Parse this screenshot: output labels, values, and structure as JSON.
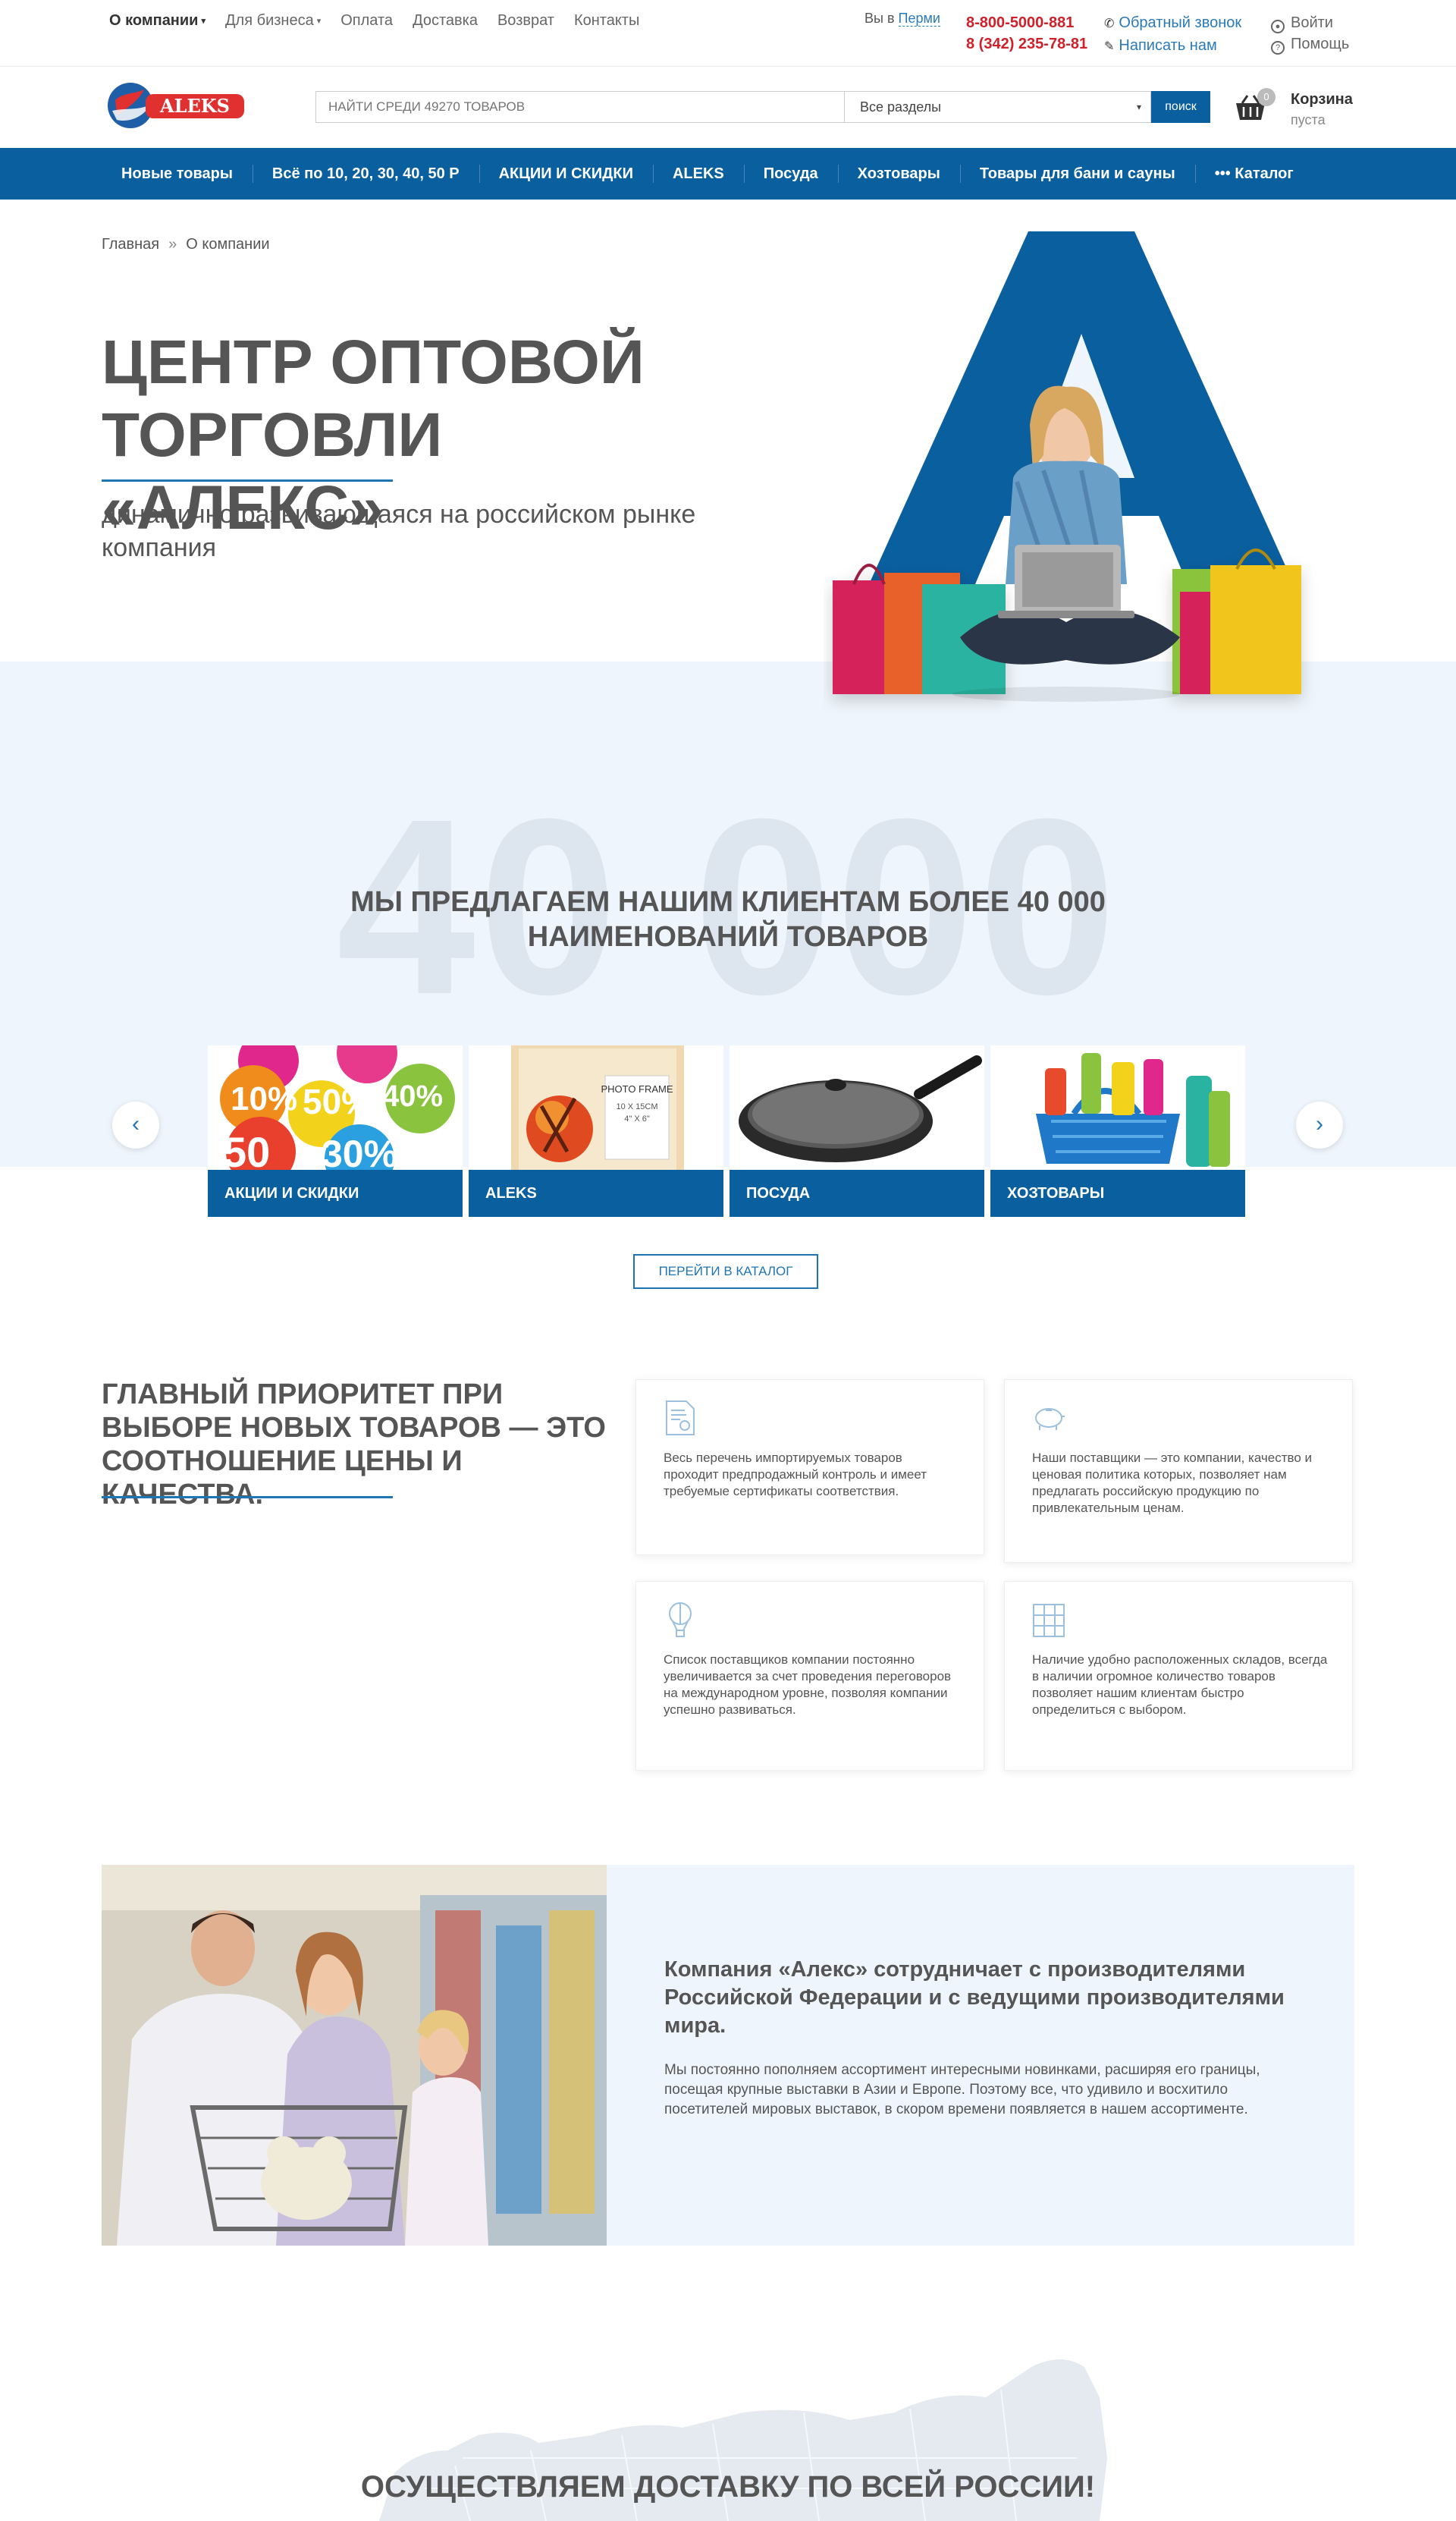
{
  "topbar": {
    "nav": [
      {
        "label": "О компании",
        "active": true,
        "dropdown": true
      },
      {
        "label": "Для бизнеса",
        "active": false,
        "dropdown": true
      },
      {
        "label": "Оплата",
        "active": false,
        "dropdown": false
      },
      {
        "label": "Доставка",
        "active": false,
        "dropdown": false
      },
      {
        "label": "Возврат",
        "active": false,
        "dropdown": false
      },
      {
        "label": "Контакты",
        "active": false,
        "dropdown": false
      }
    ],
    "city_prefix": "Вы в",
    "city": "Перми",
    "phone1": "8-800-5000-881",
    "phone2": "8 (342) 235-78-81",
    "callback": "Обратный звонок",
    "write_us": "Написать нам",
    "login": "Войти",
    "help": "Помощь"
  },
  "header": {
    "logo_text": "ALEKS",
    "search_placeholder": "НАЙТИ СРЕДИ 49270 ТОВАРОВ",
    "category_select": "Все разделы",
    "search_button": "поиск",
    "cart_count": "0",
    "cart_title": "Корзина",
    "cart_status": "пуста"
  },
  "mainnav": {
    "items": [
      "Новые товары",
      "Всё по 10, 20, 30, 40, 50 Р",
      "АКЦИИ И СКИДКИ",
      "ALEKS",
      "Посуда",
      "Хозтовары",
      "Товары для бани и сауны",
      "••• Каталог"
    ]
  },
  "hero": {
    "breadcrumb": [
      "Главная",
      "О компании"
    ],
    "title": "ЦЕНТР ОПТОВОЙ ТОРГОВЛИ «АЛЕКС»",
    "subtitle": "динамично развивающаяся на российском рынке компания"
  },
  "offer": {
    "big_number": "40 000",
    "title": "МЫ ПРЕДЛАГАЕМ НАШИМ КЛИЕНТАМ БОЛЕЕ 40 000 НАИМЕНОВАНИЙ ТОВАРОВ",
    "cards": [
      {
        "label": "АКЦИИ И СКИДКИ",
        "image": "discount-stickers"
      },
      {
        "label": "ALEKS",
        "image": "photo-frame"
      },
      {
        "label": "ПОСУДА",
        "image": "frying-pan"
      },
      {
        "label": "ХОЗТОВАРЫ",
        "image": "cleaning-supplies"
      }
    ],
    "photo_frame_text": "PHOTO FRAME",
    "photo_frame_size": "10 X 15CM",
    "photo_frame_size2": "4\" X 6\"",
    "catalog_button": "ПЕРЕЙТИ В КАТАЛОГ"
  },
  "priority": {
    "title": "ГЛАВНЫЙ ПРИОРИТЕТ ПРИ ВЫБОРЕ НОВЫХ ТОВАРОВ — ЭТО СООТНОШЕНИЕ ЦЕНЫ И КАЧЕСТВА.",
    "features": [
      {
        "icon": "certificate-icon",
        "text": "Весь перечень импортируемых товаров проходит предпродажный контроль и имеет требуемые сертификаты соответствия."
      },
      {
        "icon": "piggy-bank-icon",
        "text": "Наши поставщики — это компании, качество и ценовая политика которых, позволяет нам предлагать российскую продукцию по привлекательным ценам."
      },
      {
        "icon": "balloon-icon",
        "text": "Список поставщиков компании постоянно увеличивается за счет проведения переговоров на международном уровне, позволяя компании успешно развиваться."
      },
      {
        "icon": "warehouse-icon",
        "text": "Наличие удобно расположенных складов, всегда в наличии огромное количество товаров позволяет нашим клиентам быстро определиться с выбором."
      }
    ]
  },
  "company": {
    "title": "Компания «Алекс» сотрудничает с производителями Российской Федерации и с ведущими производителями мира.",
    "text": "Мы постоянно пополняем ассортимент интересными новинками, расширяя его границы, посещая крупные выставки в Азии и Европе. Поэтому все, что удивило и восхитило посетителей мировых выставок, в скором времени появляется в нашем ассортименте."
  },
  "delivery": {
    "title": "ОСУЩЕСТВЛЯЕМ ДОСТАВКУ ПО ВСЕЙ РОССИИ!"
  },
  "colors": {
    "brand_blue": "#0a5f9e",
    "accent_blue": "#1f75b4",
    "phone_red": "#d0202a",
    "band_bg": "#eef5fc"
  }
}
